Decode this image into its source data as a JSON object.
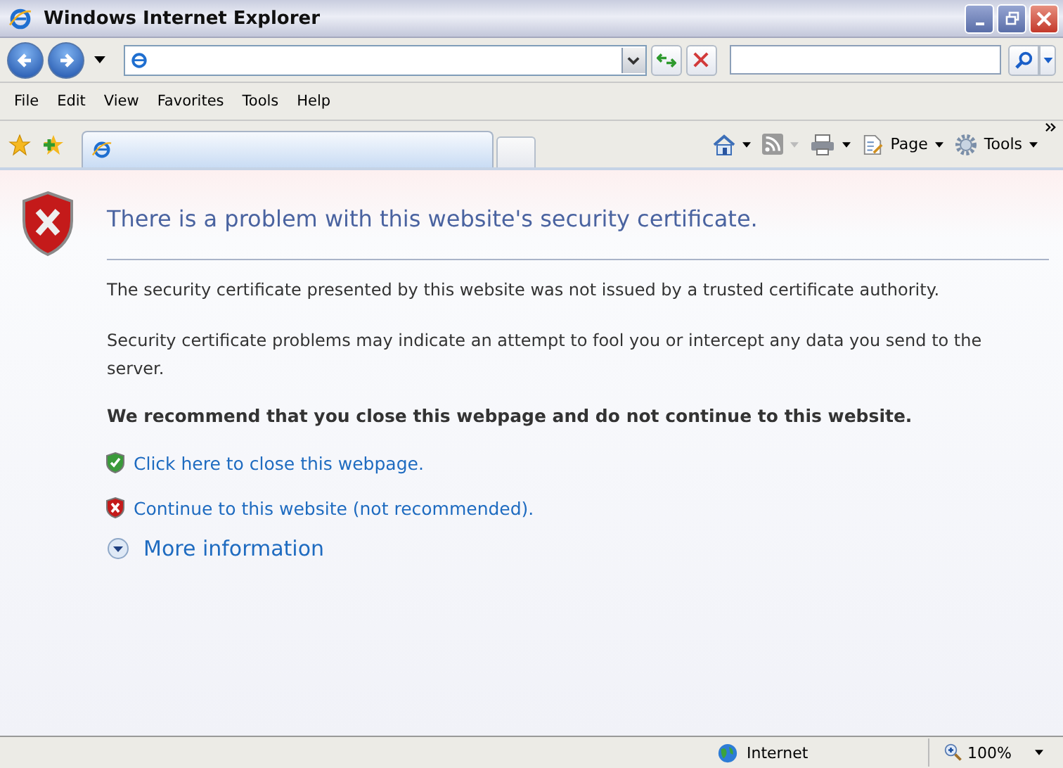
{
  "window": {
    "title": "Windows Internet Explorer"
  },
  "menu": [
    "File",
    "Edit",
    "View",
    "Favorites",
    "Tools",
    "Help"
  ],
  "command_bar": [
    {
      "kind": "home"
    },
    {
      "kind": "feed"
    },
    {
      "kind": "print"
    },
    {
      "kind": "page",
      "label": "Page"
    },
    {
      "kind": "tools",
      "label": "Tools"
    }
  ],
  "content": {
    "heading": "There is a problem with this website's security certificate.",
    "paragraphs": [
      "The security certificate presented by this website was not issued by a trusted certificate authority.",
      "Security certificate problems may indicate an attempt to fool you or intercept any data you send to the server."
    ],
    "recommendation": "We recommend that you close this webpage and do not continue to this website.",
    "actions": [
      {
        "kind": "safe",
        "label": "Click here to close this webpage."
      },
      {
        "kind": "unsafe",
        "label": "Continue to this website (not recommended)."
      }
    ],
    "more_info": "More information"
  },
  "status_bar": {
    "zone": "Internet",
    "zoom": "100%"
  }
}
